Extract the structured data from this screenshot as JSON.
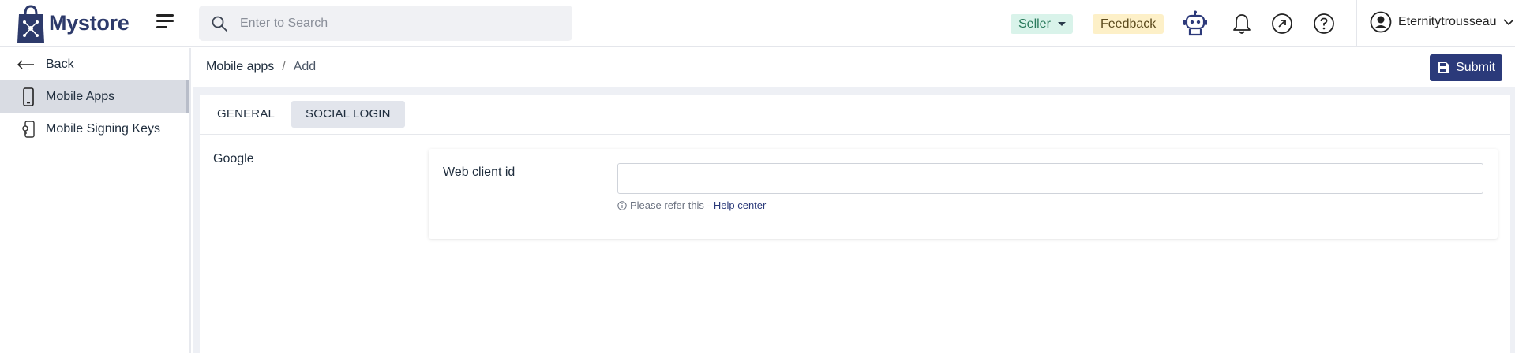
{
  "brand": {
    "name": "Mystore"
  },
  "search": {
    "placeholder": "Enter to Search"
  },
  "header": {
    "seller_label": "Seller",
    "feedback_label": "Feedback",
    "username": "Eternitytrousseau"
  },
  "sidebar": {
    "items": [
      {
        "label": "Back",
        "icon": "arrow-left-icon"
      },
      {
        "label": "Mobile Apps",
        "icon": "mobile-phone-icon",
        "active": true
      },
      {
        "label": "Mobile Signing Keys",
        "icon": "mobile-key-icon"
      }
    ]
  },
  "breadcrumb": {
    "parent": "Mobile apps",
    "separator": "/",
    "current": "Add"
  },
  "toolbar": {
    "submit_label": "Submit"
  },
  "tabs": [
    {
      "label": "GENERAL",
      "active": false
    },
    {
      "label": "SOCIAL LOGIN",
      "active": true
    }
  ],
  "form": {
    "section_label": "Google",
    "field_label": "Web client id",
    "field_value": "",
    "hint_text": "Please refer this -",
    "hint_link": "Help center"
  },
  "colors": {
    "brand": "#2d3a6b",
    "accent": "#2b3a7a",
    "seller_bg": "#d9f3ea",
    "feedback_bg": "#fdf0c8"
  }
}
